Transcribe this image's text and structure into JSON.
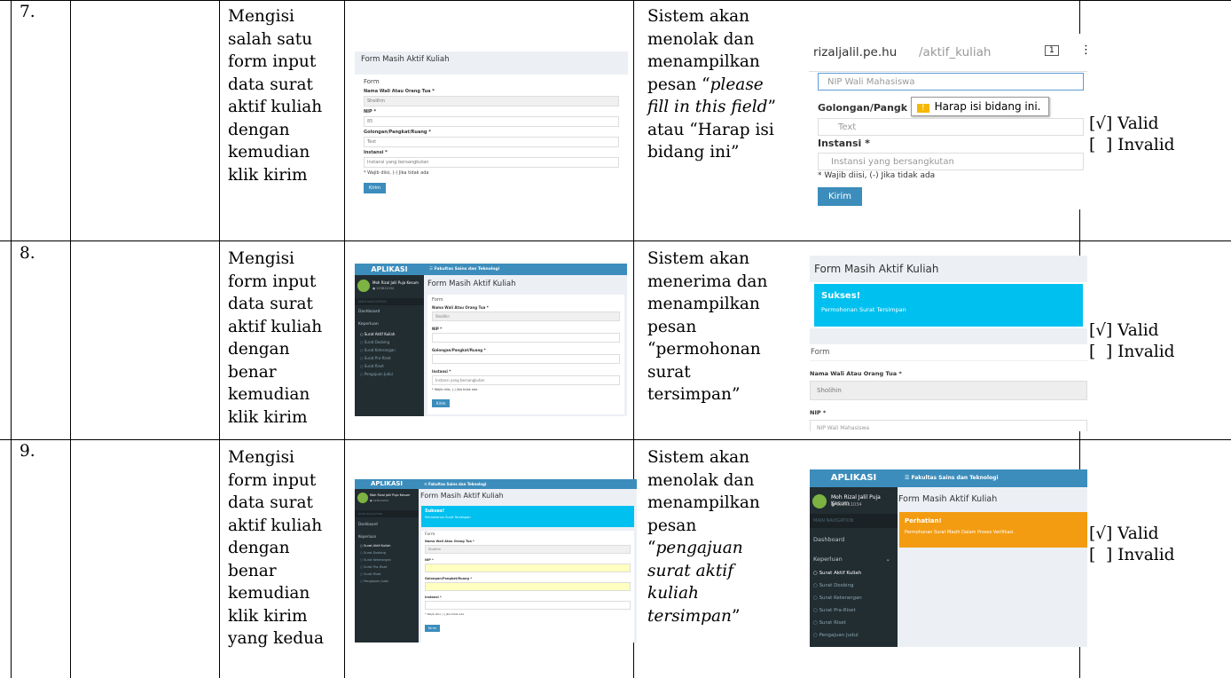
{
  "rows": [
    {
      "number": "7.",
      "step": "Mengisi\nsalah satu\nform input\ndata surat\naktif kuliah\ndengan\nkemudian\nklik kirim",
      "expected_parts": [
        "Sistem akan\nmenolak dan\nmenampilkan\npesan “",
        "please\nfill in this field",
        "”\natau “Harap isi\nbidang ini”"
      ],
      "valid": "[√] Valid",
      "invalid": "[  ] Invalid"
    },
    {
      "number": "8.",
      "step": "Mengisi\nform input\ndata surat\naktif kuliah\ndengan\nbenar\nkemudian\nklik kirim",
      "expected_parts": [
        "Sistem akan\nmenerima dan\nmenampilkan\npesan\n“permohonan\nsurat\ntersimpan”"
      ],
      "valid": "[√] Valid",
      "invalid": "[  ] Invalid"
    },
    {
      "number": "9.",
      "step": "Mengisi\nform input\ndata surat\naktif kuliah\ndengan\nbenar\nkemudian\nklik kirim\nyang kedua",
      "expected_parts": [
        "Sistem akan\nmenolak dan\nmenampilkan\npesan\n“",
        "pengajuan\nsurat aktif\nkuliah\ntersimpan",
        "”"
      ],
      "valid": "[√] Valid",
      "invalid": "[  ] Invalid"
    }
  ],
  "shots": {
    "form_title": "Form Masih Aktif Kuliah",
    "form_label": "Form",
    "wali_label": "Nama Wali Atau Orang Tua *",
    "wali_value": "Sholihin",
    "nip_label": "NIP *",
    "nip_value": "85",
    "golongan_label": "Golongan/Pangkat/Ruang *",
    "golongan_value": "Text",
    "instansi_label": "Instansi *",
    "instansi_placeholder": "Instansi yang bersangkutan",
    "note": "* Wajib diisi, (-) Jika tidak ada",
    "kirim": "Kirim",
    "url_host": "rizaljalil.pe.hu",
    "url_path": "/aktif_kuliah",
    "tab_count": "1",
    "nip_placeholder": "NIP Wali Mahasiswa",
    "golongan_short": "Golongan/Pangk",
    "tooltip": "Harap isi bidang ini.",
    "app_name": "APLIKASI",
    "faculty": "☰ Fakultas Sains dan Teknologi",
    "user_name": "Moh Rizal Jalil Puja Kesum",
    "user_id": "● 123611034",
    "nav_label": "MAIN NAVIGATION",
    "menu": [
      "Dashboard",
      "Keperluan",
      "Surat Aktif Kuliah",
      "Surat Dosbing",
      "Surat Keterangan",
      "Surat Pra-Riset",
      "Surat Riset",
      "Pengajuan Judul"
    ],
    "sukses_title": "Sukses!",
    "sukses_msg": "Permohonan Surat Tersimpan",
    "perhatian_title": "Perhatian!",
    "perhatian_msg": "Permohonan Surat Masih Dalam Proses Verifikasi.",
    "nip_placeholder_short": "NIP Wali Mahasiswa",
    "wajib": "* Wajib diisi, (-) Jika tidak ada",
    "colors": {
      "primary": "#3c8dbc",
      "sidebar": "#222d32",
      "success": "#00c0ef",
      "warning": "#f39c12"
    }
  }
}
